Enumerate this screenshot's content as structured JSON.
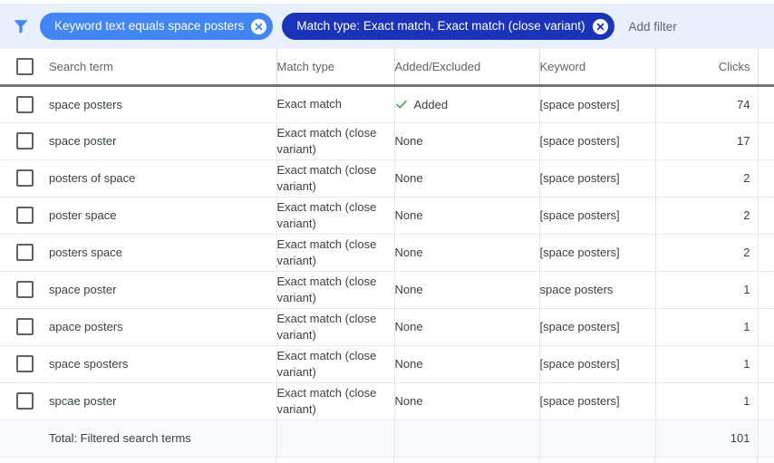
{
  "filter_bar": {
    "icon": "filter-funnel-icon",
    "accent_color": "#4285f4",
    "background_color": "#e8f0fe",
    "chips": [
      {
        "label": "Keyword text equals space posters",
        "color": "#4285f4",
        "remove_icon": "close-icon"
      },
      {
        "label": "Match type: Exact match, Exact match (close variant)",
        "color": "#1a33b8",
        "remove_icon": "close-icon"
      }
    ],
    "add_filter_label": "Add filter"
  },
  "table": {
    "columns": [
      {
        "key": "checkbox",
        "label": ""
      },
      {
        "key": "search_term",
        "label": "Search term"
      },
      {
        "key": "match_type",
        "label": "Match type"
      },
      {
        "key": "added_excluded",
        "label": "Added/Excluded"
      },
      {
        "key": "keyword",
        "label": "Keyword"
      },
      {
        "key": "clicks",
        "label": "Clicks"
      }
    ],
    "rows": [
      {
        "search_term": "space posters",
        "match_type": "Exact match",
        "added_excluded": "Added",
        "added_state": "added",
        "keyword": "[space posters]",
        "clicks": "74"
      },
      {
        "search_term": "space poster",
        "match_type": "Exact match (close variant)",
        "added_excluded": "None",
        "added_state": "none",
        "keyword": "[space posters]",
        "clicks": "17"
      },
      {
        "search_term": "posters of space",
        "match_type": "Exact match (close variant)",
        "added_excluded": "None",
        "added_state": "none",
        "keyword": "[space posters]",
        "clicks": "2"
      },
      {
        "search_term": "poster space",
        "match_type": "Exact match (close variant)",
        "added_excluded": "None",
        "added_state": "none",
        "keyword": "[space posters]",
        "clicks": "2"
      },
      {
        "search_term": "posters space",
        "match_type": "Exact match (close variant)",
        "added_excluded": "None",
        "added_state": "none",
        "keyword": "[space posters]",
        "clicks": "2"
      },
      {
        "search_term": "space poster",
        "match_type": "Exact match (close variant)",
        "added_excluded": "None",
        "added_state": "none",
        "keyword": "space posters",
        "clicks": "1"
      },
      {
        "search_term": "apace posters",
        "match_type": "Exact match (close variant)",
        "added_excluded": "None",
        "added_state": "none",
        "keyword": "[space posters]",
        "clicks": "1"
      },
      {
        "search_term": "space sposters",
        "match_type": "Exact match (close variant)",
        "added_excluded": "None",
        "added_state": "none",
        "keyword": "[space posters]",
        "clicks": "1"
      },
      {
        "search_term": "spcae poster",
        "match_type": "Exact match (close variant)",
        "added_excluded": "None",
        "added_state": "none",
        "keyword": "[space posters]",
        "clicks": "1"
      }
    ],
    "total_row": {
      "label": "Total: Filtered search terms",
      "match_type": "",
      "added_excluded": "",
      "keyword": "",
      "clicks": "101"
    },
    "added_check_color": "#34a853"
  }
}
